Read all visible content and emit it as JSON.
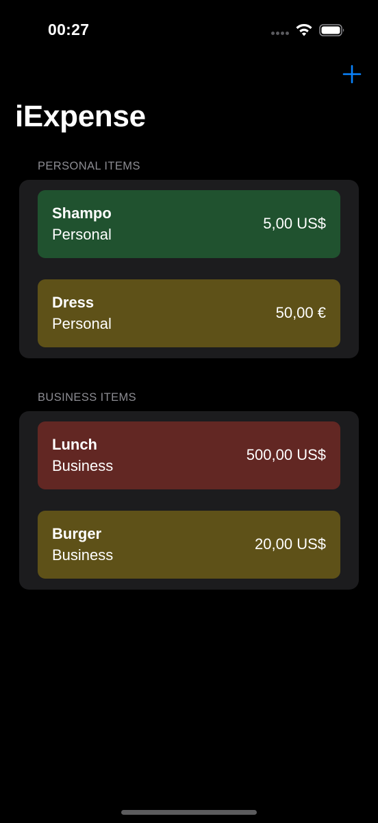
{
  "status_bar": {
    "time": "00:27"
  },
  "nav": {
    "add_icon": "plus-icon",
    "title": "iExpense"
  },
  "colors": {
    "accent": "#0a84ff",
    "background": "#000000",
    "card": "#1c1c1e",
    "secondary_text": "#8d8d93",
    "low_amount": "#20522f",
    "medium_amount": "#5e5118",
    "high_amount": "#622723"
  },
  "sections": [
    {
      "header": "PERSONAL ITEMS",
      "items": [
        {
          "name": "Shampo",
          "type": "Personal",
          "amount": "5,00 US$",
          "color": "#20522f"
        },
        {
          "name": "Dress",
          "type": "Personal",
          "amount": "50,00 €",
          "color": "#5e5118"
        }
      ]
    },
    {
      "header": "BUSINESS ITEMS",
      "items": [
        {
          "name": "Lunch",
          "type": "Business",
          "amount": "500,00 US$",
          "color": "#622723"
        },
        {
          "name": "Burger",
          "type": "Business",
          "amount": "20,00 US$",
          "color": "#5e5118"
        }
      ]
    }
  ]
}
